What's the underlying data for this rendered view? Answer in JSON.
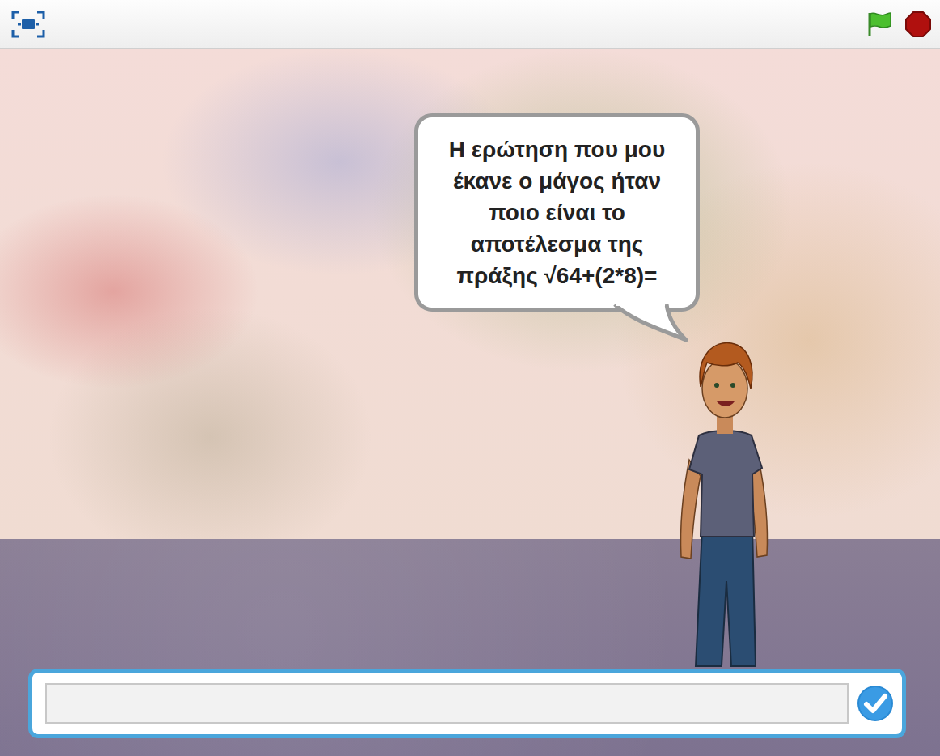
{
  "stage": {
    "speech": "Η ερώτηση που μου έκανε ο μάγος ήταν ποιο είναι το αποτέλεσμα της πράξης √64+(2*8)="
  },
  "ask": {
    "value": ""
  }
}
